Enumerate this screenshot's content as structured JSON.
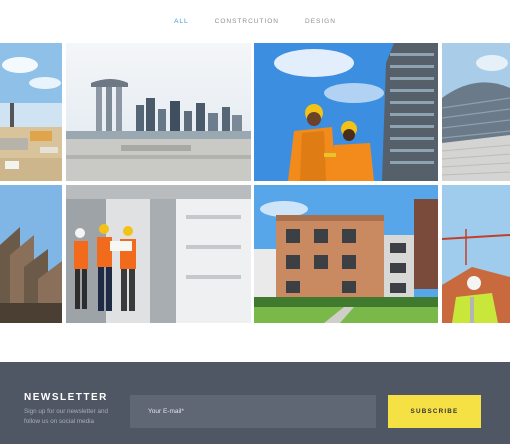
{
  "filters": {
    "tabs": [
      "ALL",
      "CONSTRCUTION",
      "DESIGN"
    ],
    "active_index": 0
  },
  "gallery": {
    "tiles": [
      "construction-site-photo",
      "city-skyline-photo",
      "engineers-with-laptop-photo",
      "modern-building-corner-photo",
      "residential-rooftops-photo",
      "workers-reviewing-plans-photo",
      "apartment-complex-photo",
      "crane-worker-photo"
    ]
  },
  "newsletter": {
    "title": "NEWSLETTER",
    "subtitle": "Sign up for our newsletter and follow us on social media",
    "email_placeholder": "Your E-mail*",
    "subscribe_label": "SUBSCRIBE"
  },
  "colors": {
    "accent": "#3a9ad9",
    "footer_bg": "#4f5664",
    "button_yellow": "#f6e145"
  }
}
